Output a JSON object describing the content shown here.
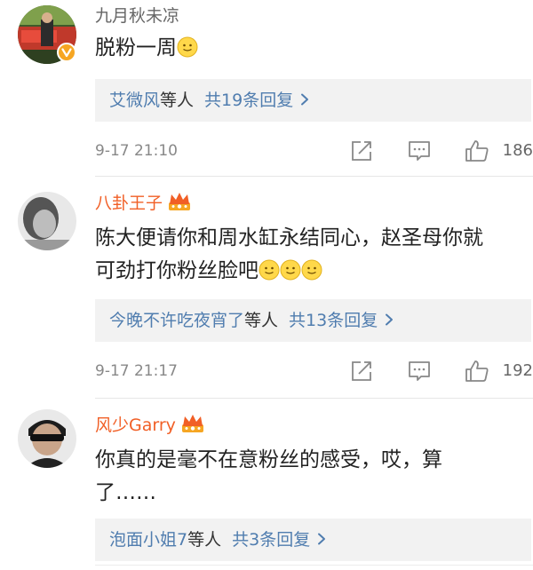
{
  "comments": [
    {
      "username": "九月秋未凉",
      "text_lines": [
        "脱粉一周"
      ],
      "smileys": 1,
      "verified": true,
      "replies": {
        "names": "艾微风",
        "suffix": "等人",
        "count_text": "共19条回复"
      },
      "time": "9-17 21:10",
      "likes": "186"
    },
    {
      "username": "八卦王子",
      "text_lines": [
        "陈大便请你和周水缸永结同心，赵圣母你就",
        "可劲打你粉丝脸吧"
      ],
      "smileys": 3,
      "vip": true,
      "replies": {
        "names": "今晚不许吃夜宵了",
        "suffix": "等人",
        "count_text": "共13条回复"
      },
      "time": "9-17 21:17",
      "likes": "192"
    },
    {
      "username": "风少Garry",
      "text_lines": [
        "你真的是毫不在意粉丝的感受，哎，算",
        "了……"
      ],
      "smileys": 0,
      "vip": true,
      "replies": {
        "names": "泡面小姐7",
        "suffix": "等人",
        "count_text": "共3条回复"
      }
    }
  ],
  "icons": {
    "repost": "share-arrow-icon",
    "comment": "comment-bubble-icon",
    "like": "thumbs-up-icon",
    "vip": "crown-badge-icon",
    "verified": "verified-v-badge-icon",
    "emoji": "smiley-emoji-icon"
  },
  "colors": {
    "vip_name": "#f15f26",
    "link": "#507daf",
    "reply_bg": "#f2f2f2",
    "meta": "#888888"
  }
}
